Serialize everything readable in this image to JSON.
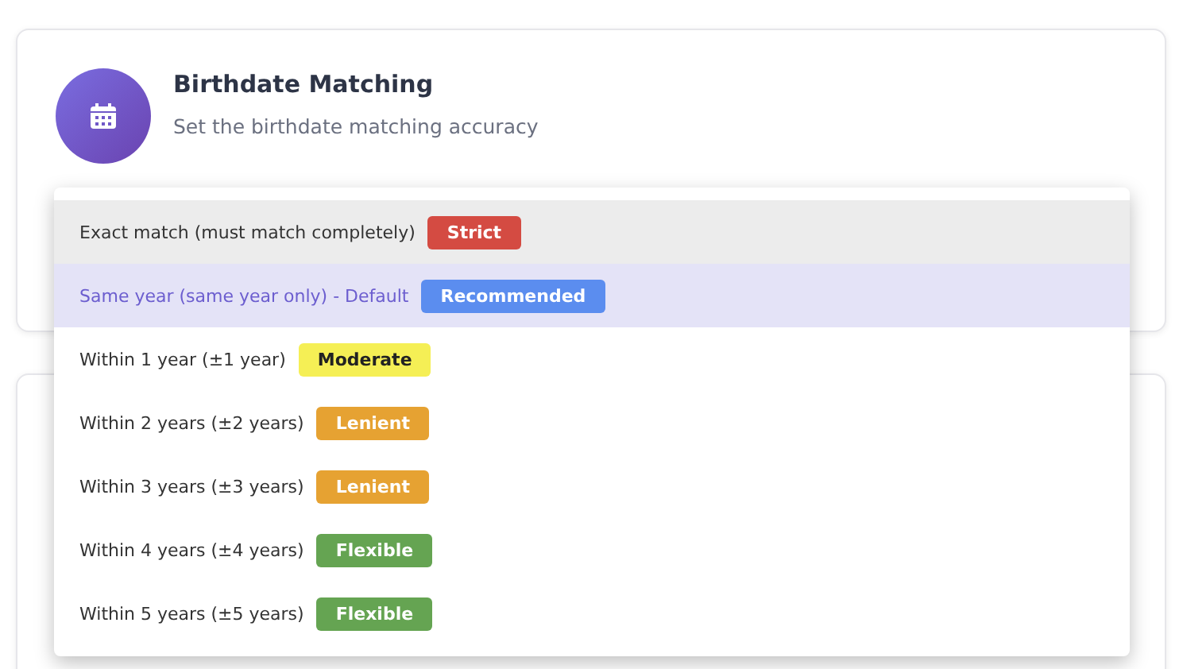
{
  "card": {
    "title": "Birthdate Matching",
    "subtitle": "Set the birthdate matching accuracy"
  },
  "dropdown": {
    "options": [
      {
        "label": "Exact match (must match completely)",
        "selected": false,
        "highlighted": true,
        "badge": {
          "text": "Strict",
          "color": "#d44b42"
        }
      },
      {
        "label": "Same year (same year only) - Default",
        "selected": true,
        "highlighted": false,
        "badge": {
          "text": "Recommended",
          "color": "#5b8def"
        }
      },
      {
        "label": "Within 1 year (±1 year)",
        "selected": false,
        "highlighted": false,
        "badge": {
          "text": "Moderate",
          "color": "#f5ef55"
        }
      },
      {
        "label": "Within 2 years (±2 years)",
        "selected": false,
        "highlighted": false,
        "badge": {
          "text": "Lenient",
          "color": "#e6a232"
        }
      },
      {
        "label": "Within 3 years (±3 years)",
        "selected": false,
        "highlighted": false,
        "badge": {
          "text": "Lenient",
          "color": "#e6a232"
        }
      },
      {
        "label": "Within 4 years (±4 years)",
        "selected": false,
        "highlighted": false,
        "badge": {
          "text": "Flexible",
          "color": "#65a452"
        }
      },
      {
        "label": "Within 5 years (±5 years)",
        "selected": false,
        "highlighted": false,
        "badge": {
          "text": "Flexible",
          "color": "#65a452"
        }
      }
    ]
  }
}
